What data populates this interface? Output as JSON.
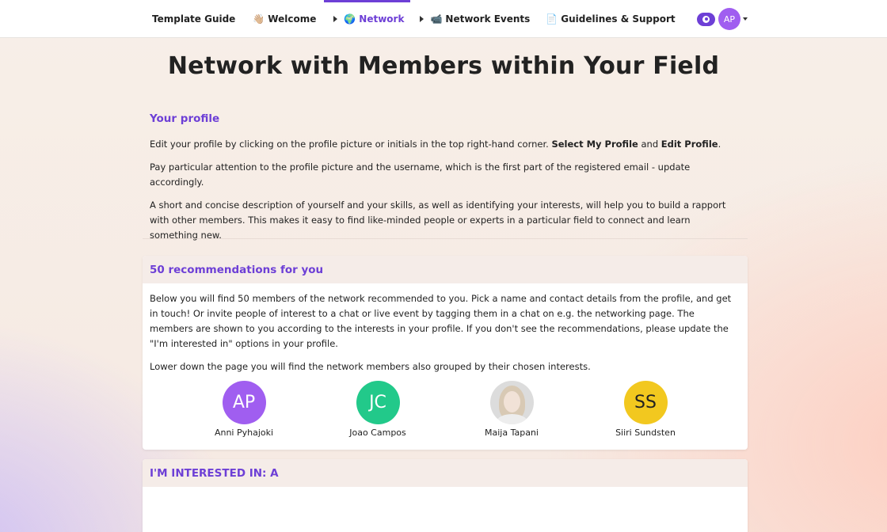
{
  "nav": {
    "items": [
      {
        "label": "Template Guide",
        "emoji": ""
      },
      {
        "label": "Welcome",
        "emoji": "👋🏼"
      },
      {
        "label": "Network",
        "emoji": "🌍"
      },
      {
        "label": "Network Events",
        "emoji": "📹"
      },
      {
        "label": "Guidelines & Support",
        "emoji": "📄"
      }
    ],
    "active": "Network"
  },
  "user": {
    "initials": "AP"
  },
  "page": {
    "title": "Network with Members within Your Field"
  },
  "profile": {
    "heading": "Your profile",
    "p1_pre": "Edit your profile by clicking on the profile picture or initials in the top right-hand corner. ",
    "p1_b1": "Select My Profile",
    "p1_mid": " and ",
    "p1_b2": "Edit Profile",
    "p1_post": ".",
    "p2": "Pay particular attention to the profile picture and the username, which is the first part of the registered email - update accordingly.",
    "p3": "A short and concise description of yourself and your skills, as well as identifying your interests, will help you to build a rapport with other members. This makes it easy to find like-minded people or experts in a particular field to connect and learn something new."
  },
  "recommendations": {
    "heading": "50 recommendations for you",
    "p1": "Below you will find 50 members of the network recommended to you. Pick a name and contact details from the profile, and get in touch! Or invite people of interest to a chat or live event by tagging them in a chat on e.g. the networking page. The members are shown to you according to the interests in your profile. If you don't see the recommendations, please update the \"I'm interested in\" options in your profile.",
    "p2": "Lower down the page you will find the network members also grouped by their chosen interests.",
    "members": [
      {
        "name": "Anni Pyhajoki",
        "initials": "AP",
        "color": "#a05ef0"
      },
      {
        "name": "Joao Campos",
        "initials": "JC",
        "color": "#22c98a"
      },
      {
        "name": "Maija Tapani",
        "initials": "",
        "color": "#dcdcdc"
      },
      {
        "name": "Siiri Sundsten",
        "initials": "SS",
        "color": "#f2c81f"
      }
    ]
  },
  "interested": {
    "heading": "I'M INTERESTED IN: A"
  }
}
